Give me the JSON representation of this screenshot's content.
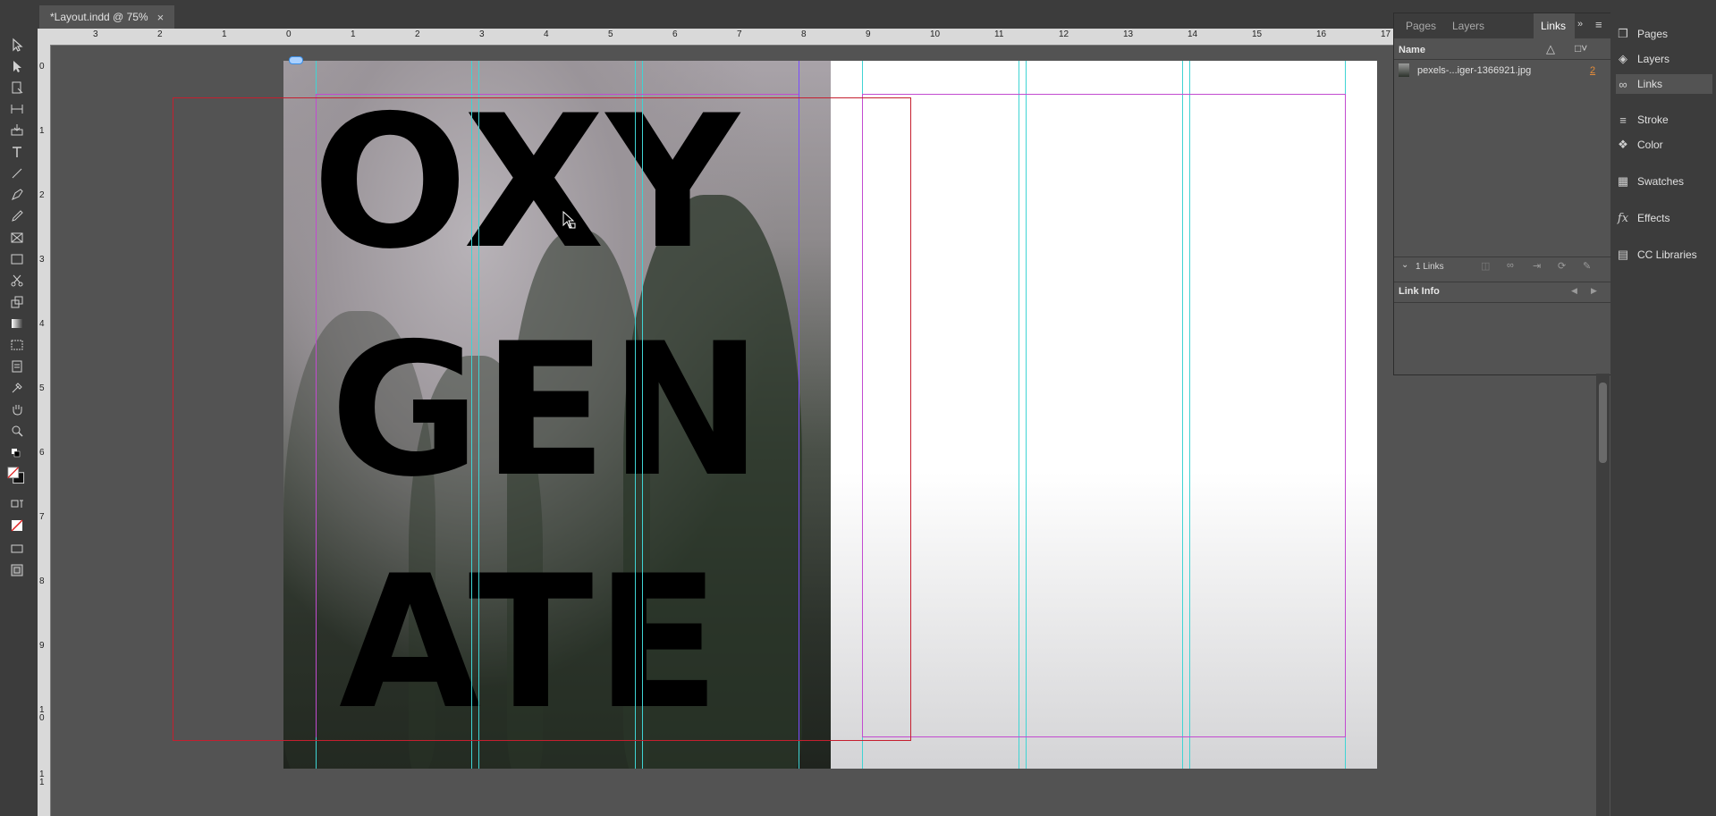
{
  "document_tab": {
    "title": "*Layout.indd @ 75%",
    "close_glyph": "×"
  },
  "ruler_h": [
    "3",
    "2",
    "1",
    "0",
    "1",
    "2",
    "3",
    "4",
    "5",
    "6",
    "7",
    "8",
    "9",
    "10",
    "11",
    "12",
    "13",
    "14",
    "15",
    "16",
    "17"
  ],
  "ruler_v": [
    "0",
    "1",
    "2",
    "3",
    "4",
    "5",
    "6",
    "7",
    "8",
    "9",
    "1\n0",
    "1\n1"
  ],
  "page": {
    "headline_lines": [
      "OXY",
      "GEN",
      "ATE"
    ],
    "image_description_color": "#2a3528"
  },
  "links_panel": {
    "tabs": [
      "Pages",
      "Layers",
      "Links"
    ],
    "active_tab": "Links",
    "column_name": "Name",
    "link_items": [
      {
        "name": "pexels-...iger-1366921.jpg",
        "page": "2"
      }
    ],
    "links_count": "1 Links",
    "link_info_label": "Link Info"
  },
  "dock": {
    "items": [
      {
        "label": "Pages",
        "icon": "pages-icon"
      },
      {
        "label": "Layers",
        "icon": "layers-icon"
      },
      {
        "label": "Links",
        "icon": "links-icon",
        "active": true
      },
      {
        "label": "Stroke",
        "icon": "stroke-icon"
      },
      {
        "label": "Color",
        "icon": "color-icon"
      },
      {
        "label": "Swatches",
        "icon": "swatches-icon"
      },
      {
        "label": "Effects",
        "icon": "fx-icon"
      },
      {
        "label": "CC Libraries",
        "icon": "cc-libraries-icon"
      }
    ]
  },
  "colors": {
    "guide_cyan": "#3fd4d4",
    "margin_magenta": "#c24bd0",
    "bleed_red": "#c51f2f",
    "ui_dark": "#3c3c3c",
    "ui_mid": "#535353"
  }
}
